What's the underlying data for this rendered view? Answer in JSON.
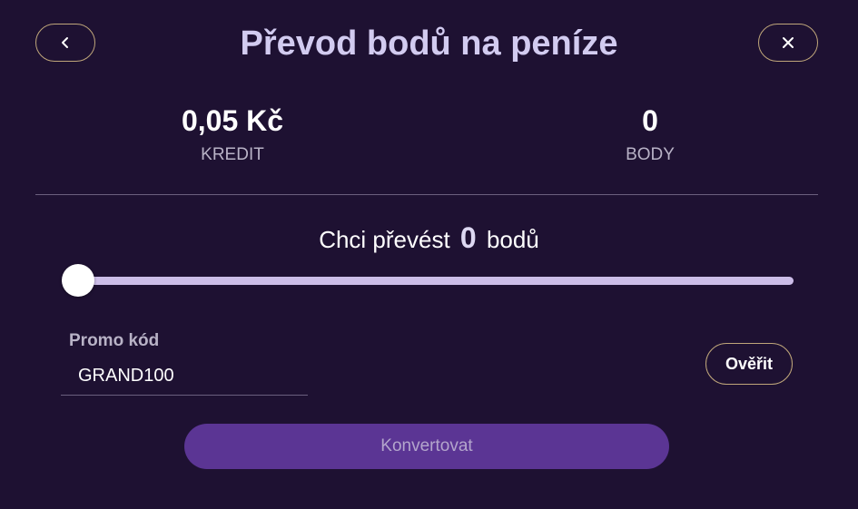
{
  "header": {
    "title": "Převod bodů na peníze",
    "back_icon": "chevron-left-icon",
    "close_icon": "close-icon"
  },
  "stats": {
    "credit": {
      "value": "0,05 Kč",
      "label": "KREDIT"
    },
    "points": {
      "value": "0",
      "label": "BODY"
    }
  },
  "converter": {
    "prefix": "Chci převést",
    "amount": "0",
    "suffix": "bodů",
    "slider_value": 0,
    "slider_min": 0,
    "slider_max": 0
  },
  "promo": {
    "label": "Promo kód",
    "value": "GRAND100",
    "verify_label": "Ověřit"
  },
  "actions": {
    "convert_label": "Konvertovat"
  },
  "colors": {
    "background": "#1e1132",
    "title": "#d2cbf0",
    "border_gold": "#bfa67a",
    "slider_track": "#ccbde8",
    "primary_button": "#5b3594",
    "primary_button_text": "#b3a5cc",
    "muted_text": "#b8b2c6"
  }
}
